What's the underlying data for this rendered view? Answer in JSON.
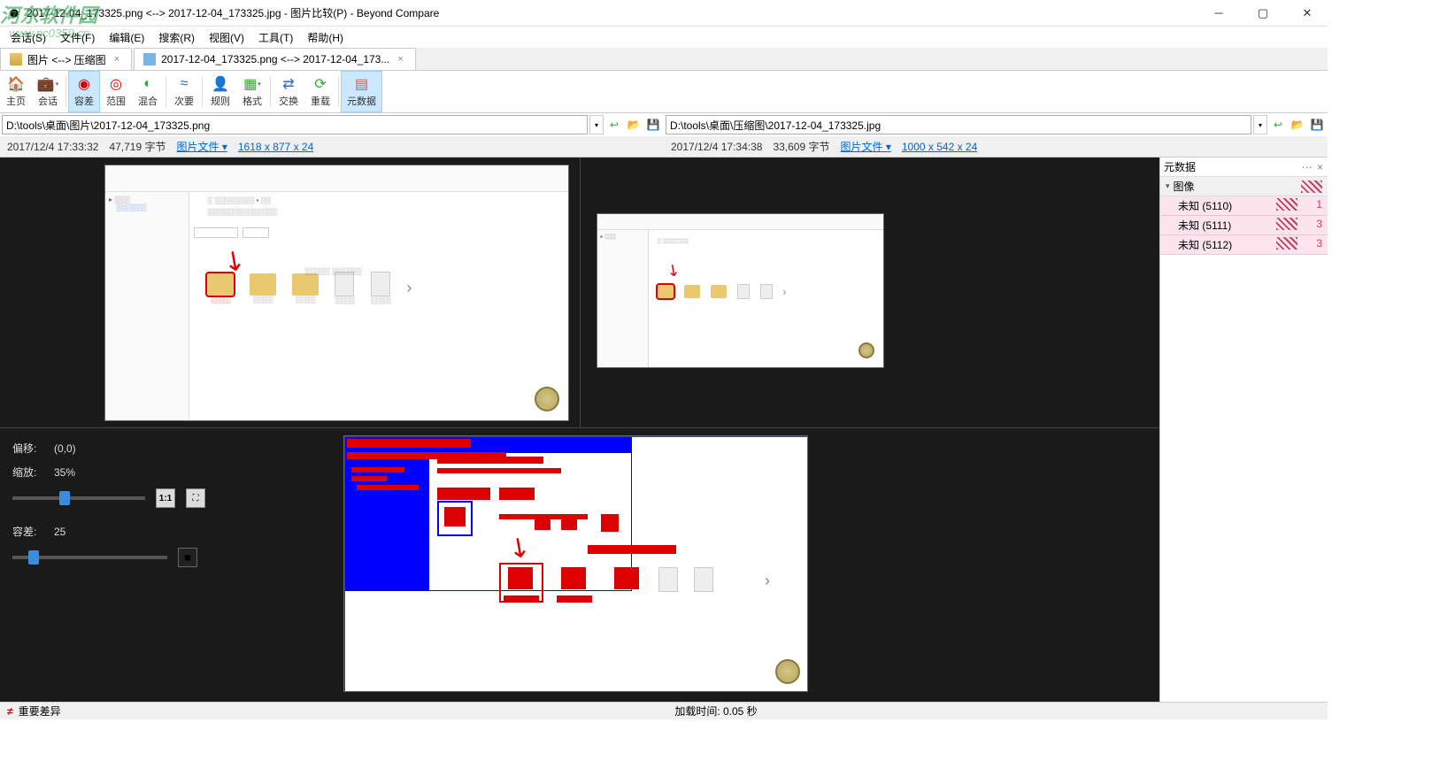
{
  "watermark": {
    "main": "河东软件园",
    "sub": "www.pc0359.cn"
  },
  "titlebar": {
    "title": "2017-12-04_173325.png <--> 2017-12-04_173325.jpg - 图片比较(P) - Beyond Compare"
  },
  "menubar": {
    "items": [
      "会话(S)",
      "文件(F)",
      "编辑(E)",
      "搜索(R)",
      "视图(V)",
      "工具(T)",
      "帮助(H)"
    ]
  },
  "tabs": [
    {
      "label": "图片 <--> 压缩图",
      "active": false
    },
    {
      "label": "2017-12-04_173325.png <--> 2017-12-04_173...",
      "active": true
    }
  ],
  "toolbar": {
    "home": "主页",
    "session": "会话",
    "tolerance": "容差",
    "range": "范围",
    "blend": "混合",
    "minor": "次要",
    "rules": "规则",
    "format": "格式",
    "swap": "交换",
    "reload": "重载",
    "metadata": "元数据"
  },
  "paths": {
    "left": "D:\\tools\\桌面\\图片\\2017-12-04_173325.png",
    "right": "D:\\tools\\桌面\\压缩图\\2017-12-04_173325.jpg"
  },
  "info": {
    "left": {
      "date": "2017/12/4 17:33:32",
      "size": "47,719 字节",
      "type": "图片文件",
      "dims": "1618 x 877 x 24"
    },
    "right": {
      "date": "2017/12/4 17:34:38",
      "size": "33,609 字节",
      "type": "图片文件",
      "dims": "1000 x 542 x 24"
    }
  },
  "controls": {
    "offset_label": "偏移:",
    "offset_val": "(0,0)",
    "zoom_label": "缩放:",
    "zoom_val": "35%",
    "tol_label": "容差:",
    "tol_val": "25"
  },
  "metadata": {
    "header": "元数据",
    "category": "图像",
    "rows": [
      {
        "k": "未知 (5110)",
        "v": "1"
      },
      {
        "k": "未知 (5111)",
        "v": "3"
      },
      {
        "k": "未知 (5112)",
        "v": "3"
      }
    ]
  },
  "status": {
    "diff": "重要差异",
    "load": "加载时间: 0.05 秒"
  }
}
